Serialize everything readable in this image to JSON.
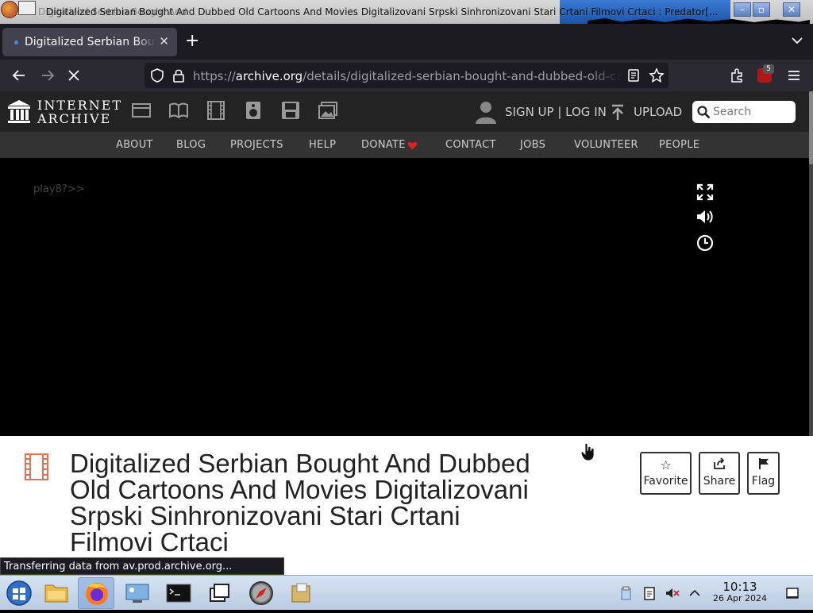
{
  "window": {
    "title": "Digitalized Serbian Bought And Dubbed Old Cartoons And Movies Digitalizovani Srpski Sinhronizovani Stari Crtani Filmovi Crtaci : Predator[...",
    "ghost_title": "Digitalized Serbian Bought And"
  },
  "browser": {
    "tab_title": "Digitalized Serbian Bought And Dubbed",
    "url_prefix": "https://",
    "url_domain": "archive.org",
    "url_path": "/details/digitalized-serbian-bought-and-dubbed-old-cartoons",
    "extension_badge": "5"
  },
  "ia": {
    "logo_line1": "INTERNET",
    "logo_line2": "ARCHIVE",
    "signup": "SIGN UP | LOG IN",
    "upload": "UPLOAD",
    "search_placeholder": "Search",
    "nav": [
      "ABOUT",
      "BLOG",
      "PROJECTS",
      "HELP",
      "DONATE",
      "CONTACT",
      "JOBS",
      "VOLUNTEER",
      "PEOPLE"
    ]
  },
  "player": {
    "text": "play8?>>"
  },
  "item": {
    "title": "Digitalized Serbian Bought And Dubbed Old Cartoons And Movies Digitalizovani Srpski Sinhronizovani Stari Crtani Filmovi Crtaci",
    "actions": [
      "Favorite",
      "Share",
      "Flag"
    ]
  },
  "status": "Transferring data from av.prod.archive.org...",
  "clock": {
    "time": "10:13",
    "date": "26 Apr 2024"
  },
  "colors": {
    "donate_heart": "#e02020",
    "film_icon": "#e07050"
  }
}
